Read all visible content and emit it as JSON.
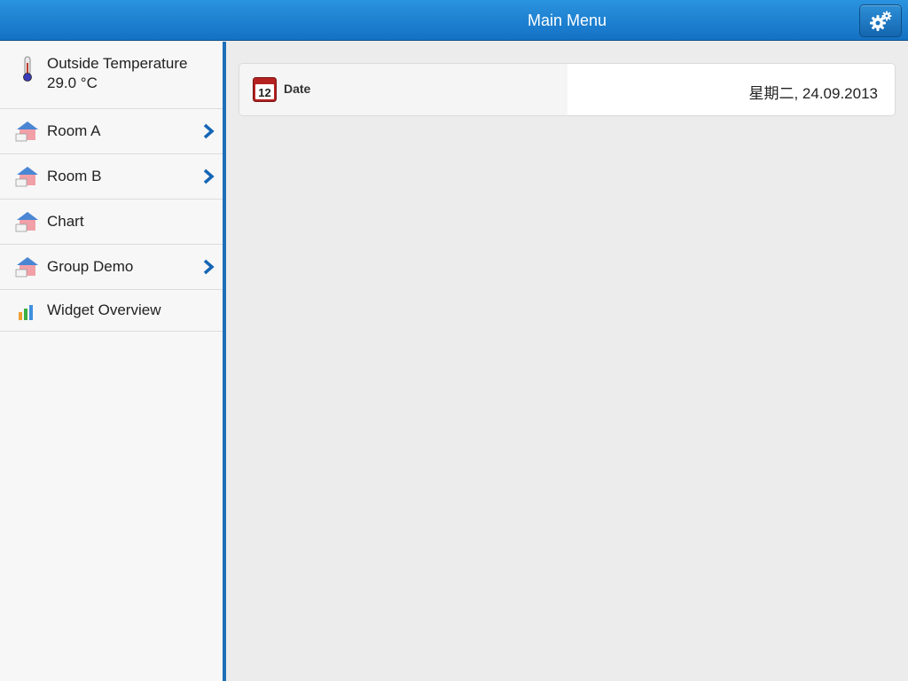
{
  "header": {
    "title": "Main Menu",
    "settings_icon": "gear-icon"
  },
  "sidebar": {
    "items": [
      {
        "label_line1": "Outside Temperature",
        "label_line2": "29.0 °C",
        "icon": "thermometer-icon",
        "has_chevron": false
      },
      {
        "label": "Room A",
        "icon": "house-icon",
        "has_chevron": true
      },
      {
        "label": "Room B",
        "icon": "house-icon",
        "has_chevron": true
      },
      {
        "label": "Chart",
        "icon": "house-icon",
        "has_chevron": false
      },
      {
        "label": "Group Demo",
        "icon": "house-icon",
        "has_chevron": true
      },
      {
        "label": "Widget Overview",
        "icon": "bar-chart-icon",
        "has_chevron": false
      }
    ]
  },
  "main": {
    "date_card": {
      "icon": "calendar-icon",
      "icon_text": "12",
      "label": "Date",
      "value": "星期二, 24.09.2013"
    }
  },
  "colors": {
    "header_blue": "#1a7fd4",
    "divider_blue": "#1e6fb8",
    "chevron_blue": "#1565b5"
  }
}
